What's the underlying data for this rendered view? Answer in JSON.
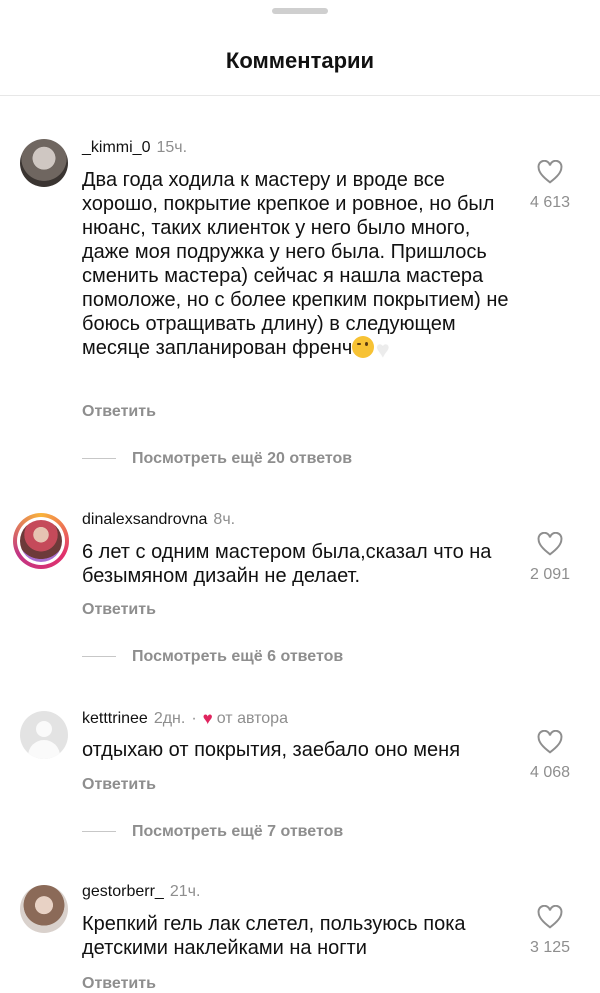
{
  "sheet": {
    "title": "Комментарии"
  },
  "comments": [
    {
      "username": "_kimmi_0",
      "time": "15ч.",
      "text": "Два года ходила к мастеру и вроде все хорошо, покрытие крепкое и ровное, но был нюанс, таких клиенток у него было много, даже моя подружка у него была. Пришлось сменить мастера) сейчас я нашла мастера помоложе, но с более крепким покрытием) не боюсь отращивать длину) в следующем месяце запланирован френч",
      "emojis": [
        "winking-face-emoji",
        "white-heart-emoji"
      ],
      "reply_label": "Ответить",
      "more_replies": "Посмотреть ещё 20 ответов",
      "likes": "4 613"
    },
    {
      "username": "dinalexsandrovna",
      "time": "8ч.",
      "text": "6 лет с одним мастером была,сказал что на безымяном дизайн не делает.",
      "reply_label": "Ответить",
      "more_replies": "Посмотреть ещё 6 ответов",
      "likes": "2 091"
    },
    {
      "username": "ketttrinee",
      "time": "2дн.",
      "author_note": "от автора",
      "text": "отдыхаю от покрытия, заебало оно меня",
      "reply_label": "Ответить",
      "more_replies": "Посмотреть ещё 7 ответов",
      "likes": "4 068"
    },
    {
      "username": "gestorberr_",
      "time": "21ч.",
      "text": "Крепкий гель лак слетел, пользуюсь пока детскими наклейками на ногти",
      "reply_label": "Ответить",
      "likes": "3 125"
    }
  ],
  "colors": {
    "text": "#111111",
    "muted": "#8e8e8e",
    "author_heart": "#e0245e"
  }
}
